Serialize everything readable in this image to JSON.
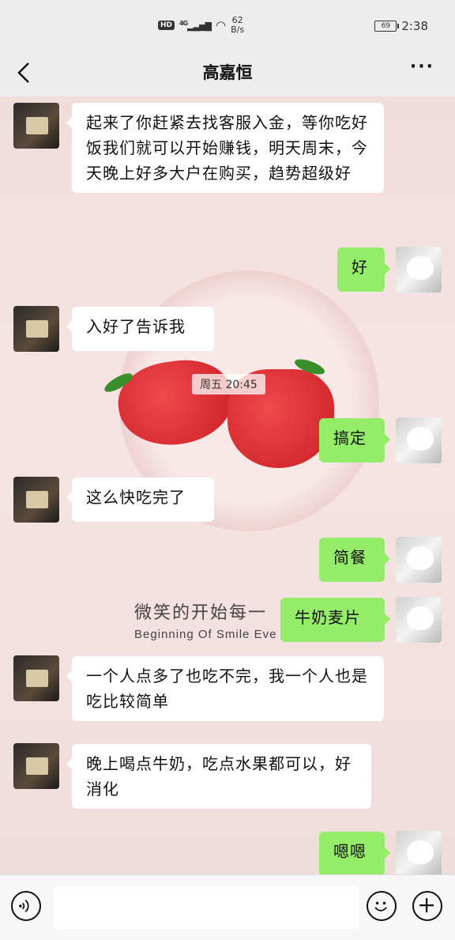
{
  "status_bar": {
    "hd": "HD",
    "network": "4G",
    "speed_value": "62",
    "speed_unit": "B/s",
    "battery": "69",
    "time": "2:38"
  },
  "header": {
    "title": "高嘉恒",
    "more": "···"
  },
  "background": {
    "slogan": "微笑的开始每一",
    "slogan_en": "Beginning Of Smile Eve"
  },
  "messages": [
    {
      "side": "left",
      "text": "起来了你赶紧去找客服入金，等你吃好饭我们就可以开始赚钱，明天周末，今天晚上好多大户在购买，趋势超级好"
    },
    {
      "side": "right",
      "text": "好"
    },
    {
      "side": "left",
      "text": "入好了告诉我"
    },
    {
      "side": "right",
      "text": "搞定"
    },
    {
      "side": "left",
      "text": "这么快吃完了"
    },
    {
      "side": "right",
      "text": "简餐"
    },
    {
      "side": "right",
      "text": "牛奶麦片"
    },
    {
      "side": "left",
      "text": "一个人点多了也吃不完，我一个人也是吃比较简单"
    },
    {
      "side": "left",
      "text": "晚上喝点牛奶，吃点水果都可以，好消化"
    },
    {
      "side": "right",
      "text": "嗯嗯"
    }
  ],
  "timestamp": "周五 20:45",
  "input_bar": {
    "voice_icon": "voice-icon",
    "emoji_icon": "emoji-icon",
    "plus_icon": "plus-icon"
  }
}
